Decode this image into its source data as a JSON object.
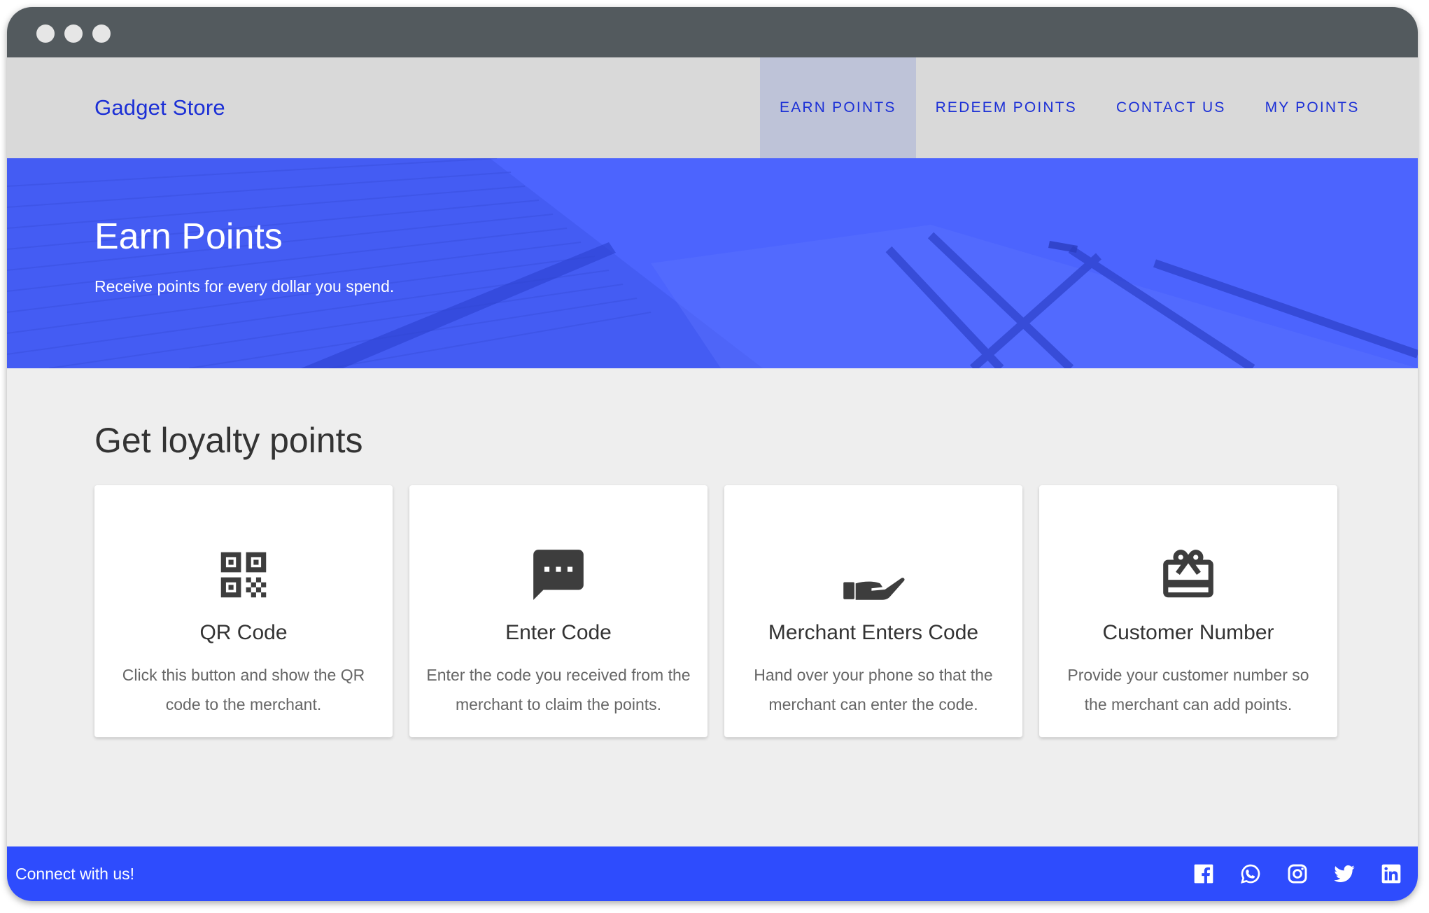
{
  "brand": "Gadget Store",
  "nav": [
    {
      "label": "EARN POINTS",
      "active": true
    },
    {
      "label": "REDEEM POINTS",
      "active": false
    },
    {
      "label": "CONTACT US",
      "active": false
    },
    {
      "label": "MY POINTS",
      "active": false
    }
  ],
  "hero": {
    "title": "Earn Points",
    "subtitle": "Receive points for every dollar you spend."
  },
  "section_title": "Get loyalty points",
  "cards": [
    {
      "icon": "qr-code-icon",
      "title": "QR Code",
      "text": "Click this button and show the QR code to the merchant."
    },
    {
      "icon": "message-icon",
      "title": "Enter Code",
      "text": "Enter the code you received from the merchant to claim the points."
    },
    {
      "icon": "hand-icon",
      "title": "Merchant Enters Code",
      "text": "Hand over your phone so that the merchant can enter the code."
    },
    {
      "icon": "gift-card-icon",
      "title": "Customer Number",
      "text": "Provide your customer number so the merchant can add points."
    }
  ],
  "footer": {
    "text": "Connect with us!",
    "socials": [
      "facebook-icon",
      "whatsapp-icon",
      "instagram-icon",
      "twitter-icon",
      "linkedin-icon"
    ]
  },
  "colors": {
    "brand": "#1b2fd6",
    "hero": "#4c64fe",
    "footer": "#2e4cfd",
    "active_nav": "#bec3d8"
  }
}
